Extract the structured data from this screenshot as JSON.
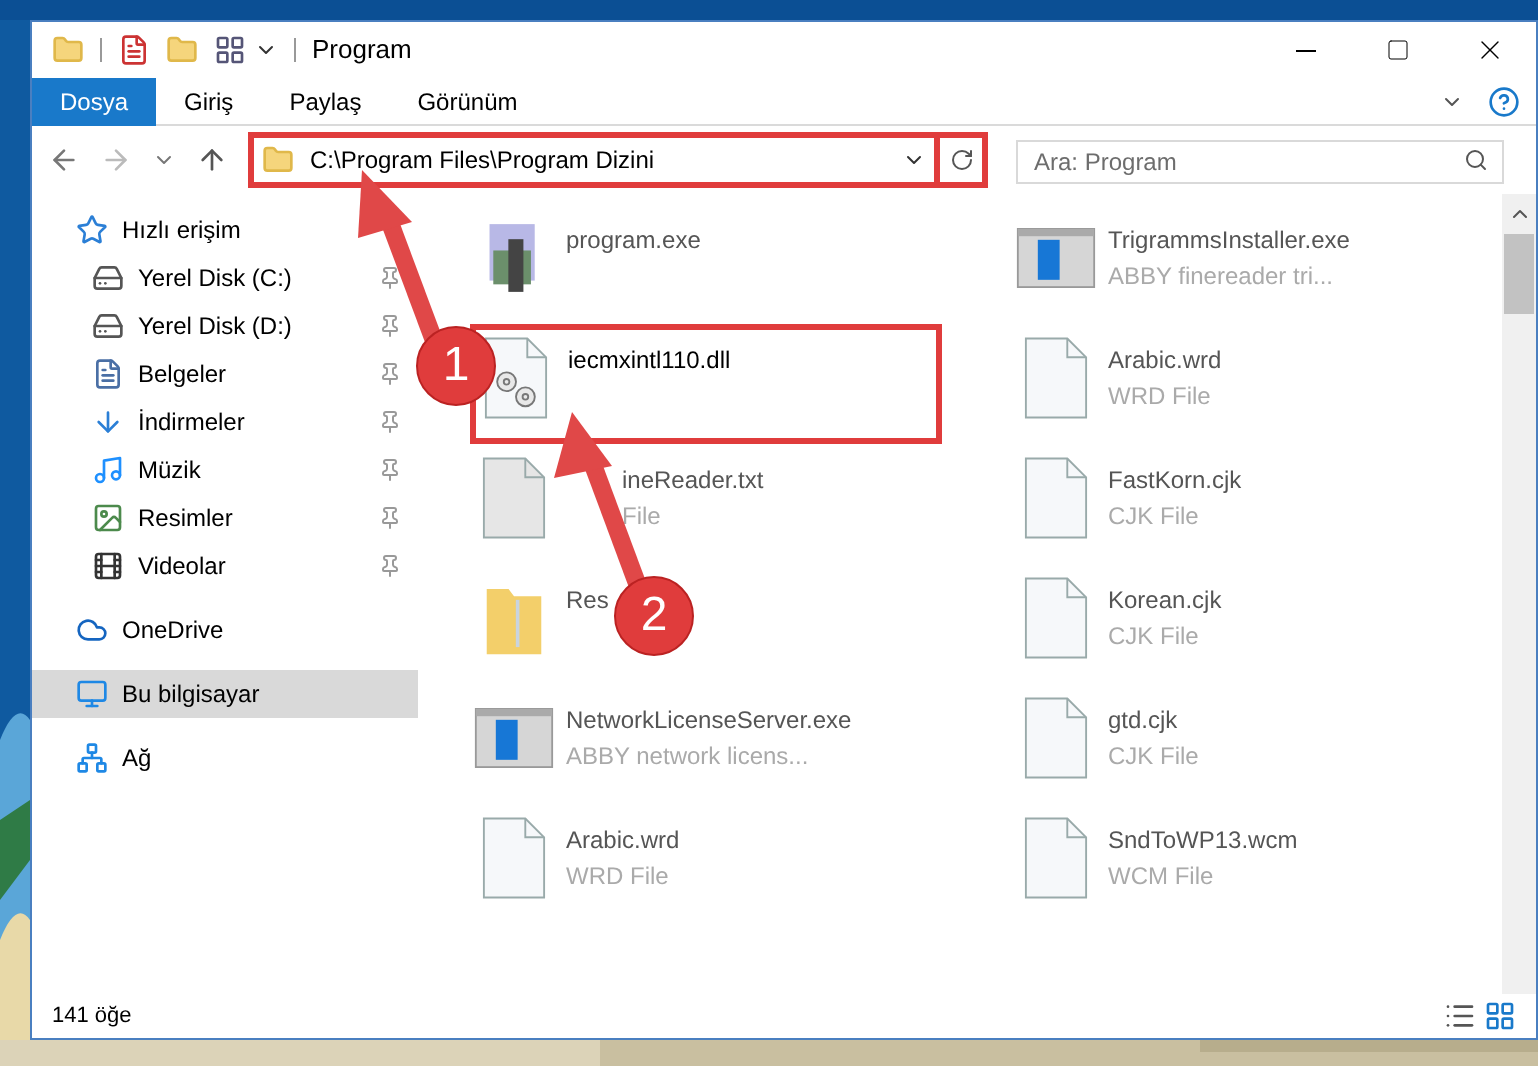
{
  "window": {
    "title": "Program"
  },
  "ribbon_tabs": [
    {
      "label": "Dosya",
      "selected": true
    },
    {
      "label": "Giriş",
      "selected": false
    },
    {
      "label": "Paylaş",
      "selected": false
    },
    {
      "label": "Görünüm",
      "selected": false
    }
  ],
  "address": {
    "value": "C:\\Program Files\\Program Dizini",
    "framed": true
  },
  "search": {
    "placeholder": "Ara: Program"
  },
  "sidebar": {
    "items": [
      {
        "label": "Hızlı erişim",
        "kind": "star",
        "selected": false,
        "children": [
          {
            "label": "Yerel Disk (C:)",
            "kind": "drive",
            "pinned": true,
            "selected": false
          },
          {
            "label": "Yerel Disk (D:)",
            "kind": "drive",
            "pinned": true,
            "selected": false
          },
          {
            "label": "Belgeler",
            "kind": "docs",
            "pinned": true,
            "selected": false
          },
          {
            "label": "İndirmeler",
            "kind": "download",
            "pinned": true,
            "selected": false
          },
          {
            "label": "Müzik",
            "kind": "music",
            "pinned": true,
            "selected": false
          },
          {
            "label": "Resimler",
            "kind": "pictures",
            "pinned": true,
            "selected": false
          },
          {
            "label": "Videolar",
            "kind": "videos",
            "pinned": true,
            "selected": false
          }
        ]
      },
      {
        "label": "OneDrive",
        "kind": "cloud",
        "selected": false
      },
      {
        "label": "Bu bilgisayar",
        "kind": "pc",
        "selected": true
      },
      {
        "label": "Ağ",
        "kind": "network",
        "selected": false
      }
    ]
  },
  "files": [
    {
      "name": "program.exe",
      "kind": "setup",
      "blurred": true,
      "framed": false
    },
    {
      "name": "TrigrammsInstaller.exe",
      "detail": "ABBY finereader tri...",
      "kind": "app",
      "blurred": true,
      "framed": false
    },
    {
      "name": "iecmxintl110.dll",
      "kind": "dll",
      "blurred": false,
      "framed": true
    },
    {
      "name": "Arabic.wrd",
      "detail": "WRD File",
      "kind": "doc",
      "blurred": true,
      "framed": false
    },
    {
      "name": "ineReader.txt",
      "detail": "File",
      "kind": "txt",
      "blurred": true,
      "framed": false,
      "covered": true
    },
    {
      "name": "FastKorn.cjk",
      "detail": "CJK File",
      "kind": "doc",
      "blurred": true,
      "framed": false
    },
    {
      "name": "Res",
      "kind": "folder",
      "blurred": true,
      "framed": false
    },
    {
      "name": "Korean.cjk",
      "detail": "CJK File",
      "kind": "doc",
      "blurred": true,
      "framed": false
    },
    {
      "name": "NetworkLicenseServer.exe",
      "detail": "ABBY network licens...",
      "kind": "app",
      "blurred": true,
      "framed": false
    },
    {
      "name": "gtd.cjk",
      "detail": "CJK File",
      "kind": "doc",
      "blurred": true,
      "framed": false
    },
    {
      "name": "Arabic.wrd",
      "detail": "WRD File",
      "kind": "doc",
      "blurred": true,
      "framed": false
    },
    {
      "name": "SndToWP13.wcm",
      "detail": "WCM File",
      "kind": "doc",
      "blurred": true,
      "framed": false
    }
  ],
  "status_bar": {
    "count": "141 öğe"
  },
  "callouts": [
    {
      "number": "1"
    },
    {
      "number": "2"
    }
  ]
}
